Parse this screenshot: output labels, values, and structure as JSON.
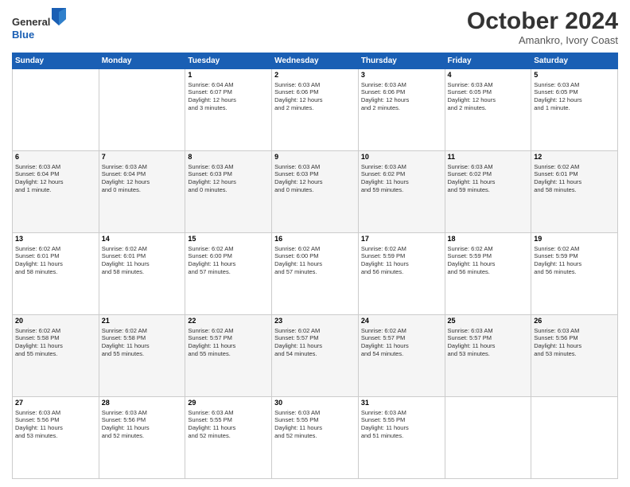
{
  "header": {
    "logo_line1": "General",
    "logo_line2": "Blue",
    "month": "October 2024",
    "location": "Amankro, Ivory Coast"
  },
  "weekdays": [
    "Sunday",
    "Monday",
    "Tuesday",
    "Wednesday",
    "Thursday",
    "Friday",
    "Saturday"
  ],
  "weeks": [
    [
      {
        "day": "",
        "info": ""
      },
      {
        "day": "",
        "info": ""
      },
      {
        "day": "1",
        "info": "Sunrise: 6:04 AM\nSunset: 6:07 PM\nDaylight: 12 hours\nand 3 minutes."
      },
      {
        "day": "2",
        "info": "Sunrise: 6:03 AM\nSunset: 6:06 PM\nDaylight: 12 hours\nand 2 minutes."
      },
      {
        "day": "3",
        "info": "Sunrise: 6:03 AM\nSunset: 6:06 PM\nDaylight: 12 hours\nand 2 minutes."
      },
      {
        "day": "4",
        "info": "Sunrise: 6:03 AM\nSunset: 6:05 PM\nDaylight: 12 hours\nand 2 minutes."
      },
      {
        "day": "5",
        "info": "Sunrise: 6:03 AM\nSunset: 6:05 PM\nDaylight: 12 hours\nand 1 minute."
      }
    ],
    [
      {
        "day": "6",
        "info": "Sunrise: 6:03 AM\nSunset: 6:04 PM\nDaylight: 12 hours\nand 1 minute."
      },
      {
        "day": "7",
        "info": "Sunrise: 6:03 AM\nSunset: 6:04 PM\nDaylight: 12 hours\nand 0 minutes."
      },
      {
        "day": "8",
        "info": "Sunrise: 6:03 AM\nSunset: 6:03 PM\nDaylight: 12 hours\nand 0 minutes."
      },
      {
        "day": "9",
        "info": "Sunrise: 6:03 AM\nSunset: 6:03 PM\nDaylight: 12 hours\nand 0 minutes."
      },
      {
        "day": "10",
        "info": "Sunrise: 6:03 AM\nSunset: 6:02 PM\nDaylight: 11 hours\nand 59 minutes."
      },
      {
        "day": "11",
        "info": "Sunrise: 6:03 AM\nSunset: 6:02 PM\nDaylight: 11 hours\nand 59 minutes."
      },
      {
        "day": "12",
        "info": "Sunrise: 6:02 AM\nSunset: 6:01 PM\nDaylight: 11 hours\nand 58 minutes."
      }
    ],
    [
      {
        "day": "13",
        "info": "Sunrise: 6:02 AM\nSunset: 6:01 PM\nDaylight: 11 hours\nand 58 minutes."
      },
      {
        "day": "14",
        "info": "Sunrise: 6:02 AM\nSunset: 6:01 PM\nDaylight: 11 hours\nand 58 minutes."
      },
      {
        "day": "15",
        "info": "Sunrise: 6:02 AM\nSunset: 6:00 PM\nDaylight: 11 hours\nand 57 minutes."
      },
      {
        "day": "16",
        "info": "Sunrise: 6:02 AM\nSunset: 6:00 PM\nDaylight: 11 hours\nand 57 minutes."
      },
      {
        "day": "17",
        "info": "Sunrise: 6:02 AM\nSunset: 5:59 PM\nDaylight: 11 hours\nand 56 minutes."
      },
      {
        "day": "18",
        "info": "Sunrise: 6:02 AM\nSunset: 5:59 PM\nDaylight: 11 hours\nand 56 minutes."
      },
      {
        "day": "19",
        "info": "Sunrise: 6:02 AM\nSunset: 5:59 PM\nDaylight: 11 hours\nand 56 minutes."
      }
    ],
    [
      {
        "day": "20",
        "info": "Sunrise: 6:02 AM\nSunset: 5:58 PM\nDaylight: 11 hours\nand 55 minutes."
      },
      {
        "day": "21",
        "info": "Sunrise: 6:02 AM\nSunset: 5:58 PM\nDaylight: 11 hours\nand 55 minutes."
      },
      {
        "day": "22",
        "info": "Sunrise: 6:02 AM\nSunset: 5:57 PM\nDaylight: 11 hours\nand 55 minutes."
      },
      {
        "day": "23",
        "info": "Sunrise: 6:02 AM\nSunset: 5:57 PM\nDaylight: 11 hours\nand 54 minutes."
      },
      {
        "day": "24",
        "info": "Sunrise: 6:02 AM\nSunset: 5:57 PM\nDaylight: 11 hours\nand 54 minutes."
      },
      {
        "day": "25",
        "info": "Sunrise: 6:03 AM\nSunset: 5:57 PM\nDaylight: 11 hours\nand 53 minutes."
      },
      {
        "day": "26",
        "info": "Sunrise: 6:03 AM\nSunset: 5:56 PM\nDaylight: 11 hours\nand 53 minutes."
      }
    ],
    [
      {
        "day": "27",
        "info": "Sunrise: 6:03 AM\nSunset: 5:56 PM\nDaylight: 11 hours\nand 53 minutes."
      },
      {
        "day": "28",
        "info": "Sunrise: 6:03 AM\nSunset: 5:56 PM\nDaylight: 11 hours\nand 52 minutes."
      },
      {
        "day": "29",
        "info": "Sunrise: 6:03 AM\nSunset: 5:55 PM\nDaylight: 11 hours\nand 52 minutes."
      },
      {
        "day": "30",
        "info": "Sunrise: 6:03 AM\nSunset: 5:55 PM\nDaylight: 11 hours\nand 52 minutes."
      },
      {
        "day": "31",
        "info": "Sunrise: 6:03 AM\nSunset: 5:55 PM\nDaylight: 11 hours\nand 51 minutes."
      },
      {
        "day": "",
        "info": ""
      },
      {
        "day": "",
        "info": ""
      }
    ]
  ]
}
